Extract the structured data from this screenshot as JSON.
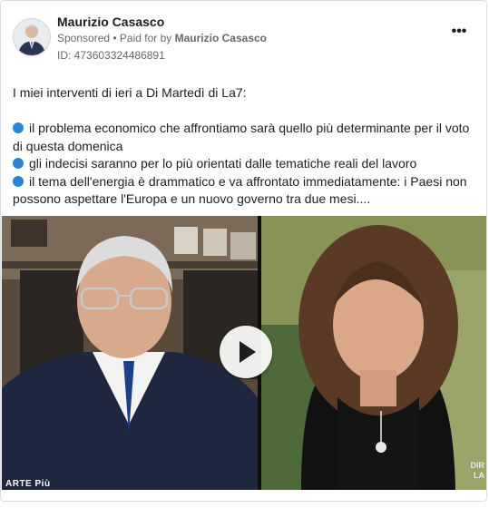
{
  "post": {
    "page_name": "Maurizio Casasco",
    "sponsored_label": "Sponsored",
    "separator": " • ",
    "paid_for_prefix": "Paid for by ",
    "payer_name": "Maurizio Casasco",
    "ad_id": "ID: 473603324486891",
    "more_icon": "more-horizontal-icon",
    "more_label": "•••"
  },
  "body": {
    "intro": "I miei interventi di ieri a Di Martedì di La7:",
    "bullet_icon": "blue-circle-icon",
    "bullet_color": "#2d84d7",
    "bullets": [
      "il problema economico che affrontiamo sarà quello più determinante per il voto di questa domenica",
      "gli indecisi saranno per lo più orientati dalle tematiche reali del lavoro",
      "il tema dell'energia è drammatico e va affrontato immediatamente: i Paesi non possono aspettare l'Europa e un nuovo governo tra due mesi...."
    ]
  },
  "video": {
    "play_icon": "play-icon",
    "logo_left": "ARTE Più",
    "logo_right_1": "DIR",
    "logo_right_2": "LA"
  }
}
